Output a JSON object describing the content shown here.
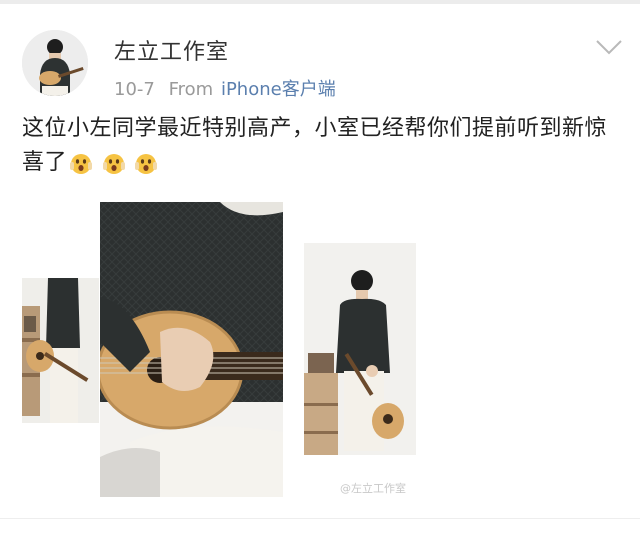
{
  "post": {
    "username": "左立工作室",
    "date": "10-7",
    "from_label": "From",
    "source": "iPhone客户端",
    "text": "这位小左同学最近特别高产，小室已经帮你们提前听到新惊喜了",
    "emojis": [
      "astonished-emoji",
      "astonished-emoji",
      "astonished-emoji"
    ],
    "watermark": "@左立工作室"
  },
  "colors": {
    "source_link": "#5b7fae",
    "meta_gray": "#9a9a9a",
    "sweater": "#2c3030",
    "guitar_body": "#d7a86a",
    "pants": "#f4f1ea"
  }
}
